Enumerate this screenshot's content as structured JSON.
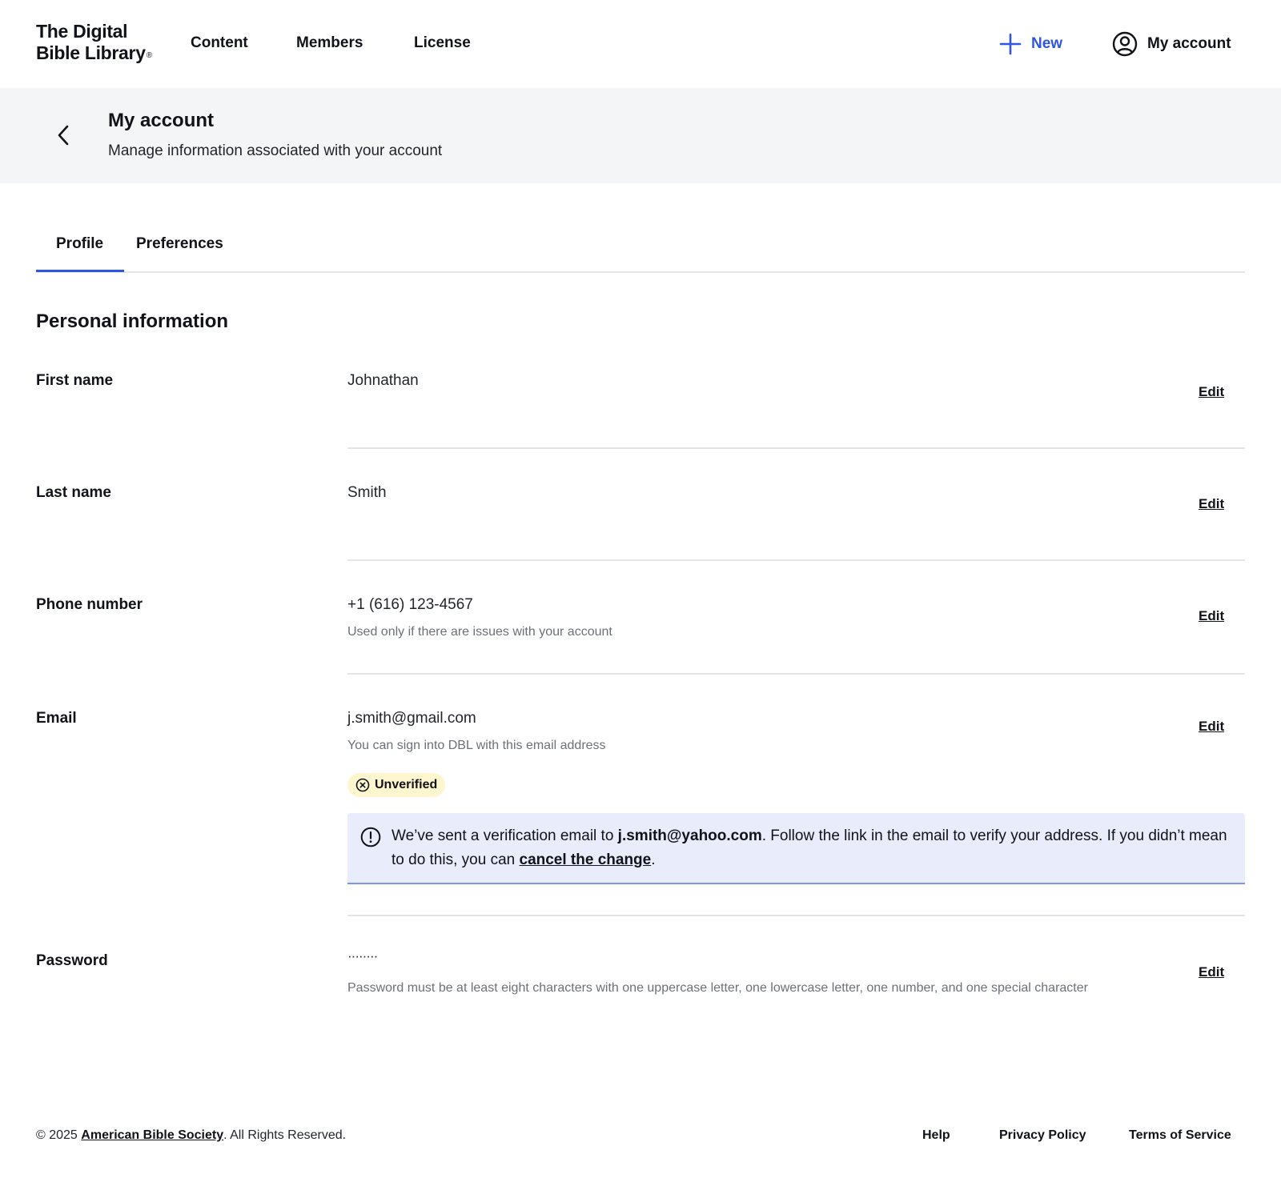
{
  "brand": {
    "logo_line1": "The Digital",
    "logo_line2": "Bible Library",
    "logo_reg": "®"
  },
  "nav": {
    "content": "Content",
    "members": "Members",
    "license": "License",
    "new": "New",
    "account": "My account"
  },
  "header": {
    "title": "My account",
    "subtitle": "Manage information associated with your account"
  },
  "tabs": [
    {
      "label": "Profile",
      "active": true
    },
    {
      "label": "Preferences",
      "active": false
    }
  ],
  "section": {
    "title": "Personal information"
  },
  "fields": {
    "first_name": {
      "label": "First name",
      "value": "Johnathan",
      "edit": "Edit"
    },
    "last_name": {
      "label": "Last name",
      "value": "Smith",
      "edit": "Edit"
    },
    "phone": {
      "label": "Phone number",
      "value": "+1 (616) 123-4567",
      "help": "Used only if there are issues with your account",
      "edit": "Edit"
    },
    "email": {
      "label": "Email",
      "value": "j.smith@gmail.com",
      "help": "You can sign into DBL with this email address",
      "edit": "Edit",
      "badge": "Unverified",
      "alert": {
        "part1": "We’ve sent a verification email to ",
        "email": "j.smith@yahoo.com",
        "part2": ". Follow the link in the email to verify your address. If you didn’t mean to do this, you can ",
        "link": "cancel the change",
        "part3": "."
      }
    },
    "password": {
      "label": "Password",
      "value": "········",
      "help": "Password must be at least eight characters with one uppercase letter, one lowercase letter, one number, and one special character",
      "edit": "Edit"
    }
  },
  "footer": {
    "copyright_prefix": "© 2025 ",
    "org": "American Bible Society",
    "copyright_suffix": ". All Rights Reserved.",
    "help": "Help",
    "privacy": "Privacy Policy",
    "terms": "Terms of Service"
  },
  "colors": {
    "accent": "#2f55e4",
    "band": "#f4f5f7",
    "badge_bg": "#fdf6cf",
    "alert_bg": "#e9ecfb",
    "alert_border": "#7e94ee"
  },
  "icons": {
    "new": "plus-icon",
    "account": "user-circle-icon",
    "back": "chevron-left-icon",
    "badge": "x-circle-icon",
    "alert": "exclamation-circle-icon"
  }
}
